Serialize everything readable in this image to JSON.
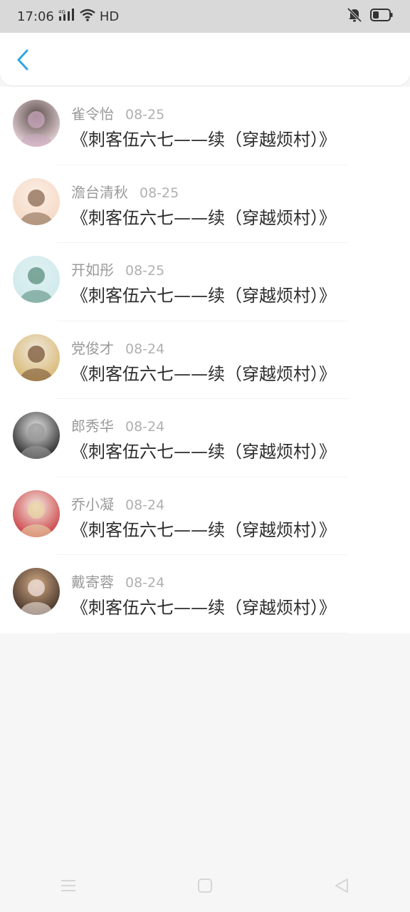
{
  "status_bar": {
    "time": "17:06",
    "network": "4G",
    "hd": "HD"
  },
  "header": {
    "back_icon": "chevron-left-icon"
  },
  "comments": [
    {
      "name": "雀令怡",
      "date": "08-25",
      "title": "《刺客伍六七——续（穿越烦村）》",
      "avatar_colors": [
        "#5a4b47",
        "#f2dfe5",
        "#cba9c0"
      ]
    },
    {
      "name": "澹台清秋",
      "date": "08-25",
      "title": "《刺客伍六七——续（穿越烦村）》",
      "avatar_colors": [
        "#fbeee4",
        "#f5d8c4",
        "#8a6a52"
      ]
    },
    {
      "name": "开如彤",
      "date": "08-25",
      "title": "《刺客伍六七——续（穿越烦村）》",
      "avatar_colors": [
        "#dff1f3",
        "#cfe9ea",
        "#5b8f7e"
      ]
    },
    {
      "name": "党俊才",
      "date": "08-24",
      "title": "《刺客伍六七——续（穿越烦村）》",
      "avatar_colors": [
        "#efe8de",
        "#d8b66b",
        "#7a5636"
      ]
    },
    {
      "name": "郎秀华",
      "date": "08-24",
      "title": "《刺客伍六七——续（穿越烦村）》",
      "avatar_colors": [
        "#e8e8e8",
        "#1a1a1a",
        "#9a9a9a"
      ]
    },
    {
      "name": "乔小凝",
      "date": "08-24",
      "title": "《刺客伍六七——续（穿越烦村）》",
      "avatar_colors": [
        "#f4ece2",
        "#c8333a",
        "#e8d4a3"
      ]
    },
    {
      "name": "戴寄蓉",
      "date": "08-24",
      "title": "《刺客伍六七——续（穿越烦村）》",
      "avatar_colors": [
        "#d2aa84",
        "#3a2a22",
        "#f0e2dc"
      ]
    }
  ],
  "nav_bar": {
    "menu_icon": "menu-icon",
    "home_icon": "home-square-icon",
    "back_icon": "back-triangle-icon"
  },
  "colors": {
    "accent": "#2ca7e0",
    "name_text": "#9a9a9a",
    "title_text": "#2d2d2d",
    "background": "#f7f6f7"
  }
}
